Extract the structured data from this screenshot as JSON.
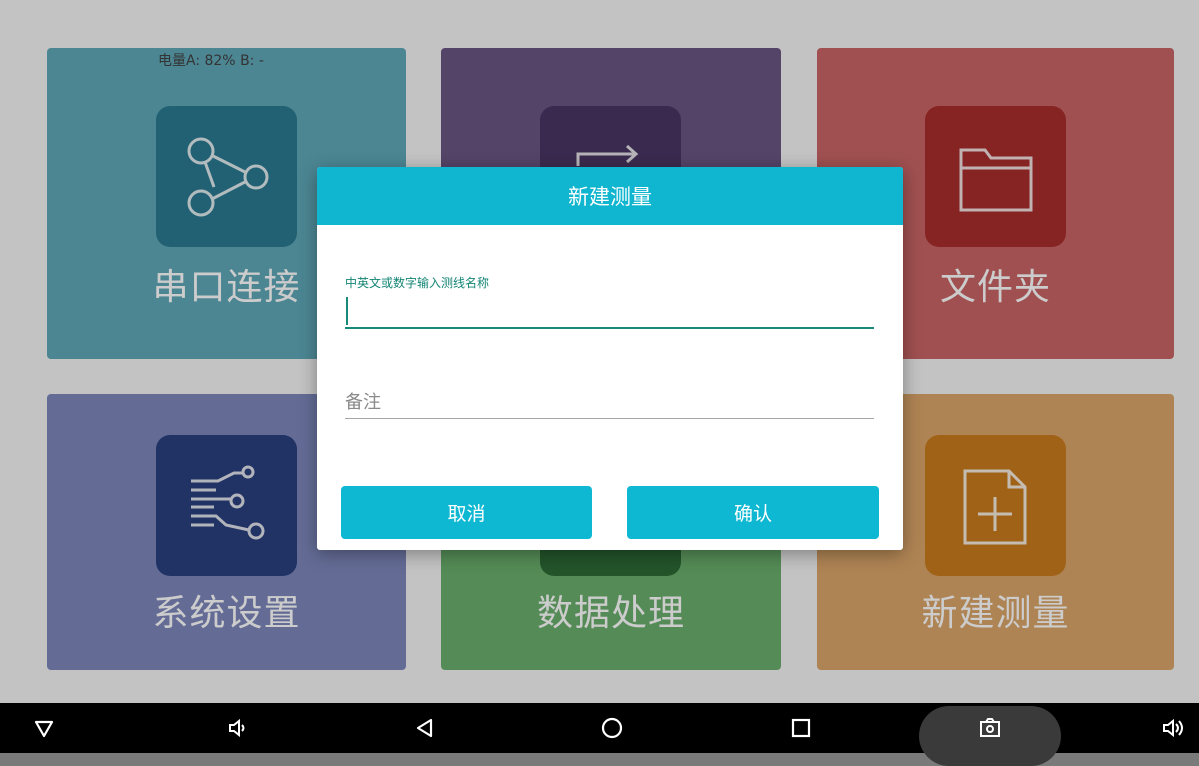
{
  "status": {
    "battery_text": "电量A: 82%   B: -"
  },
  "tiles": [
    {
      "label": "串口连接",
      "icon": "share-node-icon",
      "color": "#5fa8b8"
    },
    {
      "label": "",
      "icon": "repeat-icon",
      "color": "#6a5682"
    },
    {
      "label": "文件夹",
      "icon": "folder-icon",
      "color": "#c96565"
    },
    {
      "label": "系统设置",
      "icon": "settings-circuit-icon",
      "color": "#7d88bc"
    },
    {
      "label": "数据处理",
      "icon": "data-icon",
      "color": "#6aae6c"
    },
    {
      "label": "新建测量",
      "icon": "new-file-icon",
      "color": "#dba66a"
    }
  ],
  "dialog": {
    "title": "新建测量",
    "name_hint": "中英文或数字输入测线名称",
    "name_value": "",
    "remark_placeholder": "备注",
    "cancel_label": "取消",
    "confirm_label": "确认",
    "accent": "#10b5cf"
  },
  "navbar": {
    "items": [
      "triangle-down-icon",
      "volume-down-icon",
      "back-icon",
      "home-icon",
      "recents-icon",
      "screenshot-icon",
      "volume-up-icon"
    ]
  }
}
